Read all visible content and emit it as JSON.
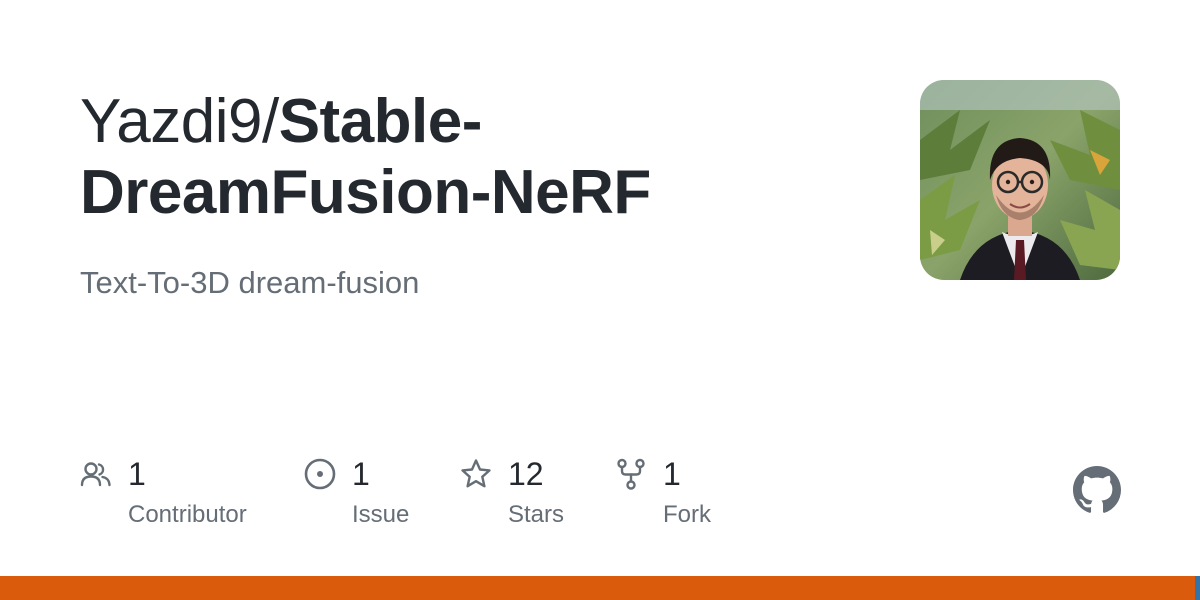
{
  "repo": {
    "owner": "Yazdi9/",
    "name_line1": "Stable-",
    "name_line2": "DreamFusion-NeRF",
    "description": "Text-To-3D dream-fusion"
  },
  "stats": [
    {
      "icon": "people-icon",
      "count": "1",
      "label": "Contributor"
    },
    {
      "icon": "issue-icon",
      "count": "1",
      "label": "Issue"
    },
    {
      "icon": "star-icon",
      "count": "12",
      "label": "Stars"
    },
    {
      "icon": "fork-icon",
      "count": "1",
      "label": "Fork"
    }
  ],
  "branding": {
    "logo_icon": "github-logo-icon",
    "avatar_icon": "owner-avatar"
  },
  "colors": {
    "text_primary": "#24292f",
    "text_secondary": "#656d76",
    "language_bar": [
      "#DA5B0B",
      "#3572A5"
    ]
  },
  "language_bar": [
    {
      "color": "#DA5B0B",
      "share": 0.996
    },
    {
      "color": "#3572A5",
      "share": 0.004
    }
  ]
}
